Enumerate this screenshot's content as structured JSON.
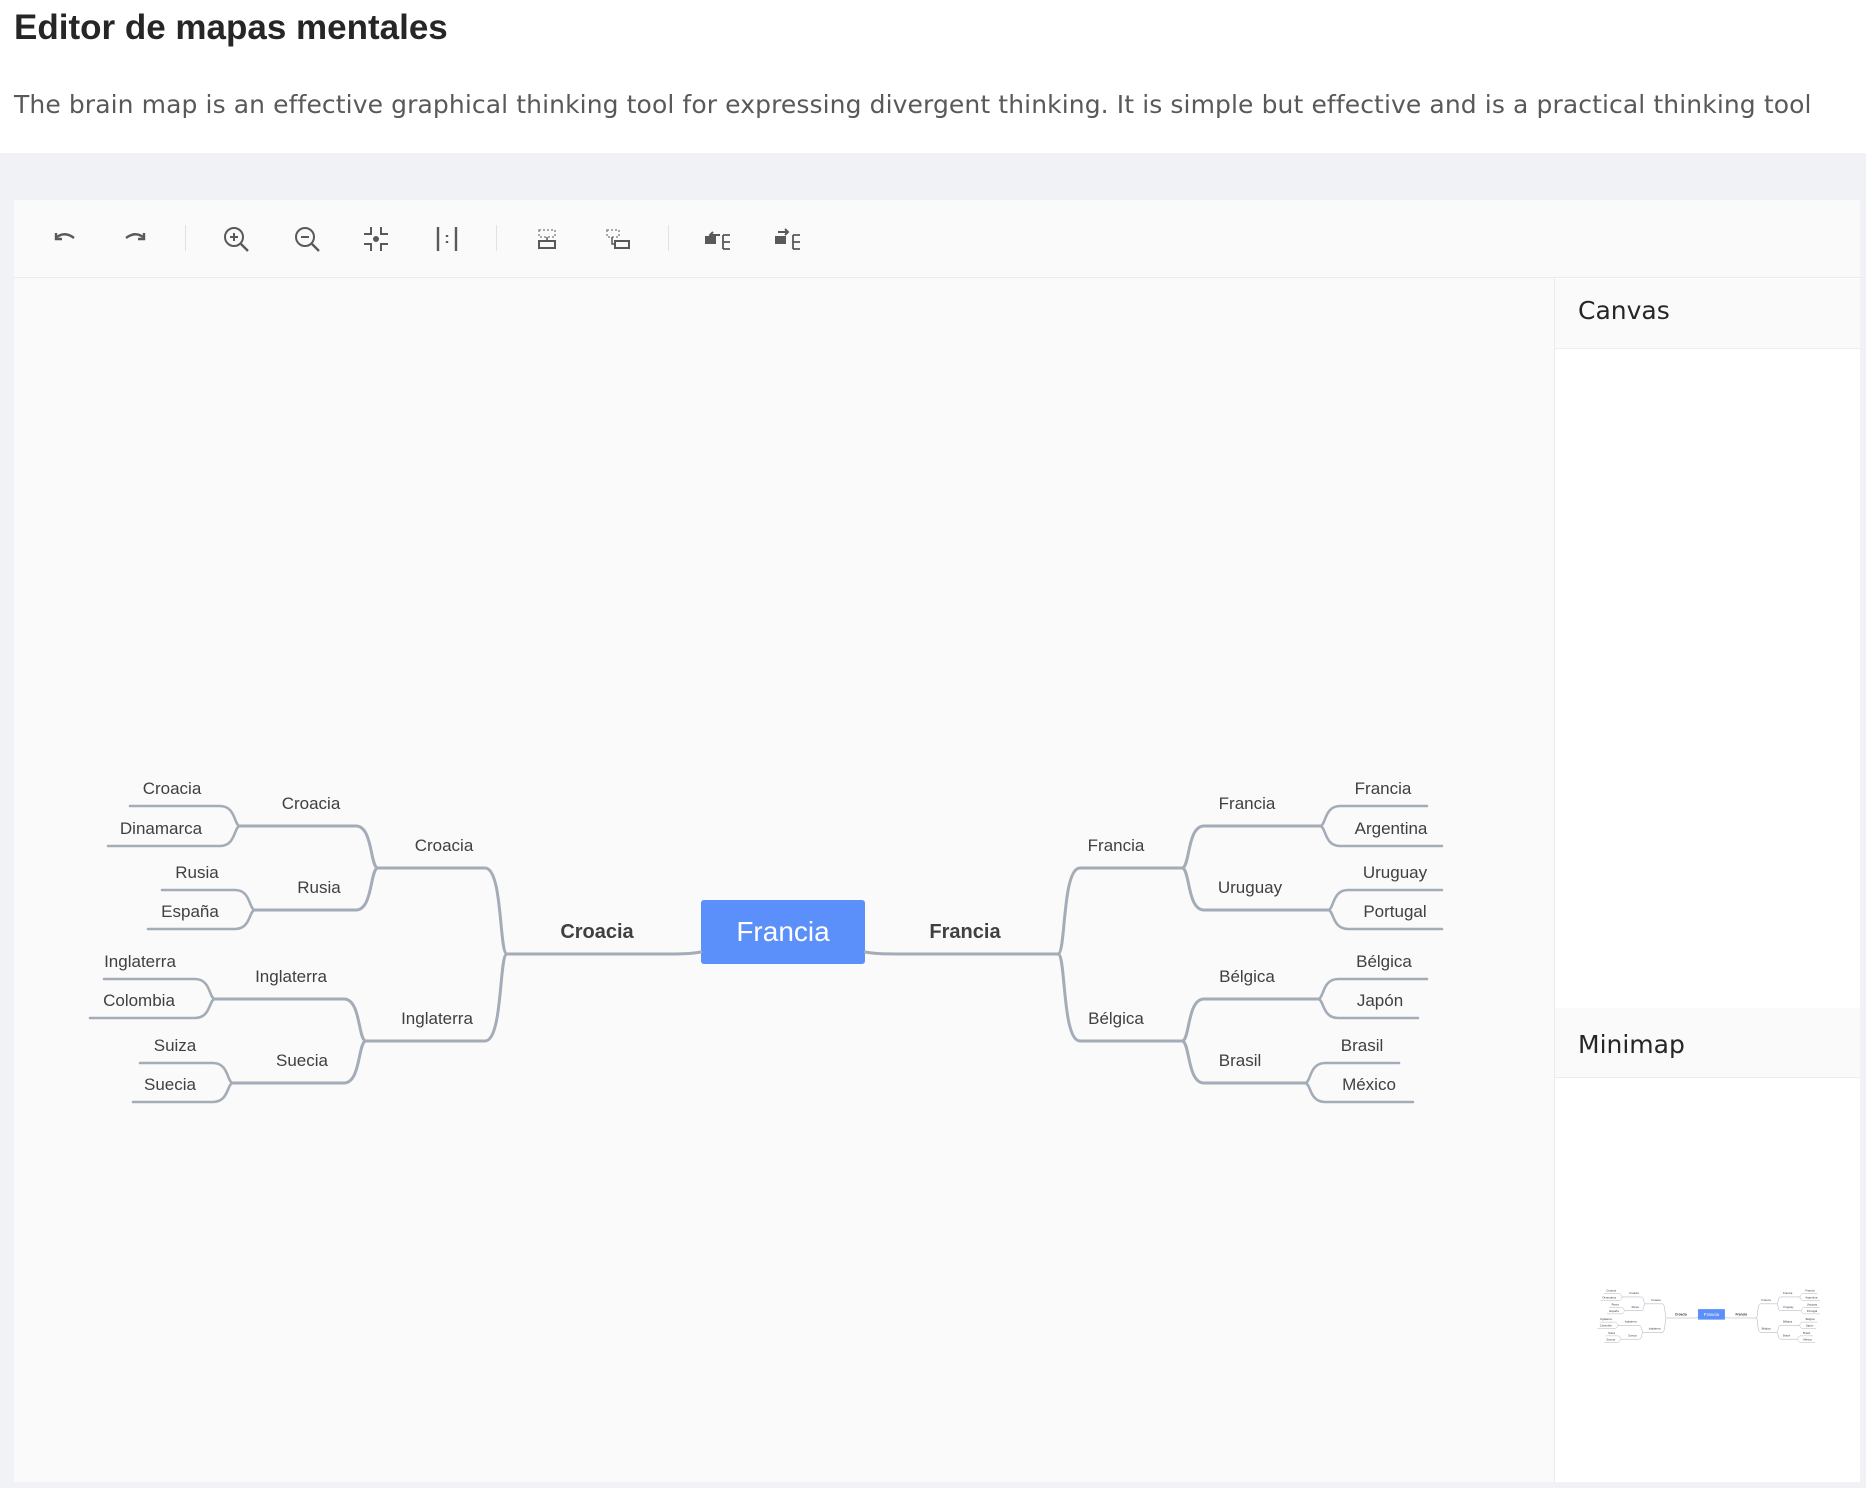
{
  "page": {
    "title": "Editor de mapas mentales",
    "description": "The brain map is an effective graphical thinking tool for expressing divergent thinking. It is simple but effective and is a practical thinking tool"
  },
  "toolbar": {
    "buttons": [
      {
        "icon": "undo-icon"
      },
      {
        "icon": "redo-icon"
      },
      {
        "icon": "zoom-in-icon"
      },
      {
        "icon": "zoom-out-icon"
      },
      {
        "icon": "fit-view-icon"
      },
      {
        "icon": "actual-size-icon"
      },
      {
        "icon": "add-child-icon"
      },
      {
        "icon": "add-sibling-icon"
      },
      {
        "icon": "collapse-icon"
      },
      {
        "icon": "expand-icon"
      }
    ]
  },
  "panels": {
    "canvas_title": "Canvas",
    "minimap_title": "Minimap"
  },
  "mindmap": {
    "root": "Francia",
    "left": {
      "label": "Croacia",
      "children": [
        {
          "label": "Croacia",
          "children": [
            {
              "label": "Croacia",
              "children": [
                "Croacia",
                "Dinamarca"
              ]
            },
            {
              "label": "Rusia",
              "children": [
                "Rusia",
                "España"
              ]
            }
          ]
        },
        {
          "label": "Inglaterra",
          "children": [
            {
              "label": "Inglaterra",
              "children": [
                "Inglaterra",
                "Colombia"
              ]
            },
            {
              "label": "Suecia",
              "children": [
                "Suiza",
                "Suecia"
              ]
            }
          ]
        }
      ]
    },
    "right": {
      "label": "Francia",
      "children": [
        {
          "label": "Francia",
          "children": [
            {
              "label": "Francia",
              "children": [
                "Francia",
                "Argentina"
              ]
            },
            {
              "label": "Uruguay",
              "children": [
                "Uruguay",
                "Portugal"
              ]
            }
          ]
        },
        {
          "label": "Bélgica",
          "children": [
            {
              "label": "Bélgica",
              "children": [
                "Bélgica",
                "Japón"
              ]
            },
            {
              "label": "Brasil",
              "children": [
                "Brasil",
                "México"
              ]
            }
          ]
        }
      ]
    }
  },
  "colors": {
    "root_fill": "#5b8ff9",
    "edge": "#a3acb7",
    "edge_dark": "#8d96a3"
  }
}
